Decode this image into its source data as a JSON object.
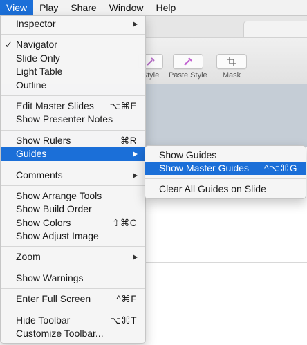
{
  "menubar": {
    "items": [
      {
        "label": "View",
        "active": true
      },
      {
        "label": "Play"
      },
      {
        "label": "Share"
      },
      {
        "label": "Window"
      },
      {
        "label": "Help"
      }
    ]
  },
  "toolbar": {
    "tools": [
      {
        "label": "Style",
        "icon": "copy-style-icon"
      },
      {
        "label": "Paste Style",
        "icon": "paste-style-icon"
      },
      {
        "label": "Mask",
        "icon": "mask-icon"
      }
    ]
  },
  "view_menu": {
    "inspector": "Inspector",
    "navigator": "Navigator",
    "navigator_check": "✓",
    "slide_only": "Slide Only",
    "light_table": "Light Table",
    "outline": "Outline",
    "edit_master_slides": "Edit Master Slides",
    "edit_master_slides_shortcut": "⌥⌘E",
    "show_presenter_notes": "Show Presenter Notes",
    "show_rulers": "Show Rulers",
    "show_rulers_shortcut": "⌘R",
    "guides": "Guides",
    "comments": "Comments",
    "show_arrange_tools": "Show Arrange Tools",
    "show_build_order": "Show Build Order",
    "show_colors": "Show Colors",
    "show_colors_shortcut": "⇧⌘C",
    "show_adjust_image": "Show Adjust Image",
    "zoom": "Zoom",
    "show_warnings": "Show Warnings",
    "enter_full_screen": "Enter Full Screen",
    "enter_full_screen_shortcut": "^⌘F",
    "hide_toolbar": "Hide Toolbar",
    "hide_toolbar_shortcut": "⌥⌘T",
    "customize_toolbar": "Customize Toolbar..."
  },
  "guides_submenu": {
    "show_guides": "Show Guides",
    "show_master_guides": "Show Master Guides",
    "show_master_guides_shortcut": "^⌥⌘G",
    "clear_all_guides": "Clear All Guides on Slide"
  },
  "colors": {
    "highlight": "#1b6fd8",
    "canvas_header": "#c5cdd6"
  }
}
